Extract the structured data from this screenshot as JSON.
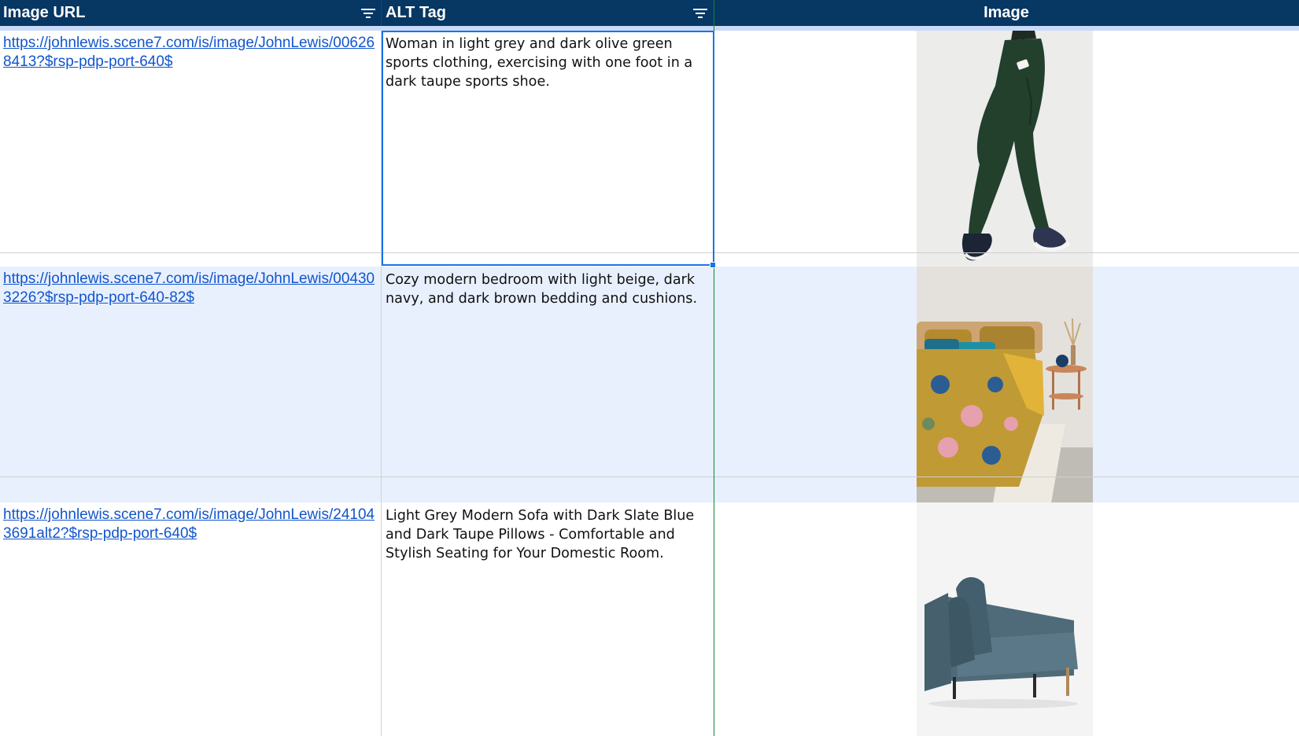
{
  "header": {
    "col_url": "Image URL",
    "col_alt": "ALT Tag",
    "col_image": "Image"
  },
  "rows": [
    {
      "url": "https://johnlewis.scene7.com/is/image/JohnLewis/006268413?$rsp-pdp-port-640$",
      "alt": "Woman in light grey and dark olive green sports clothing, exercising with one foot in a dark taupe sports shoe.",
      "image_subject": "green-leggings-product-photo"
    },
    {
      "url": "https://johnlewis.scene7.com/is/image/JohnLewis/004303226?$rsp-pdp-port-640-82$",
      "alt": "Cozy modern bedroom with light beige, dark navy, and dark brown bedding and cushions.",
      "image_subject": "floral-bedding-bedroom-photo"
    },
    {
      "url": "https://johnlewis.scene7.com/is/image/JohnLewis/241043691alt2?$rsp-pdp-port-640$",
      "alt": "Light Grey Modern Sofa with Dark Slate Blue and Dark Taupe Pillows - Comfortable and Stylish Seating for Your Domestic Room.",
      "image_subject": "blue-grey-sofa-product-photo"
    }
  ],
  "icons": {
    "filter": "filter-icon"
  },
  "colors": {
    "header_bg": "#073763",
    "link": "#1155cc",
    "selection": "#1a73e8",
    "banded_row": "#e8f0fe"
  }
}
